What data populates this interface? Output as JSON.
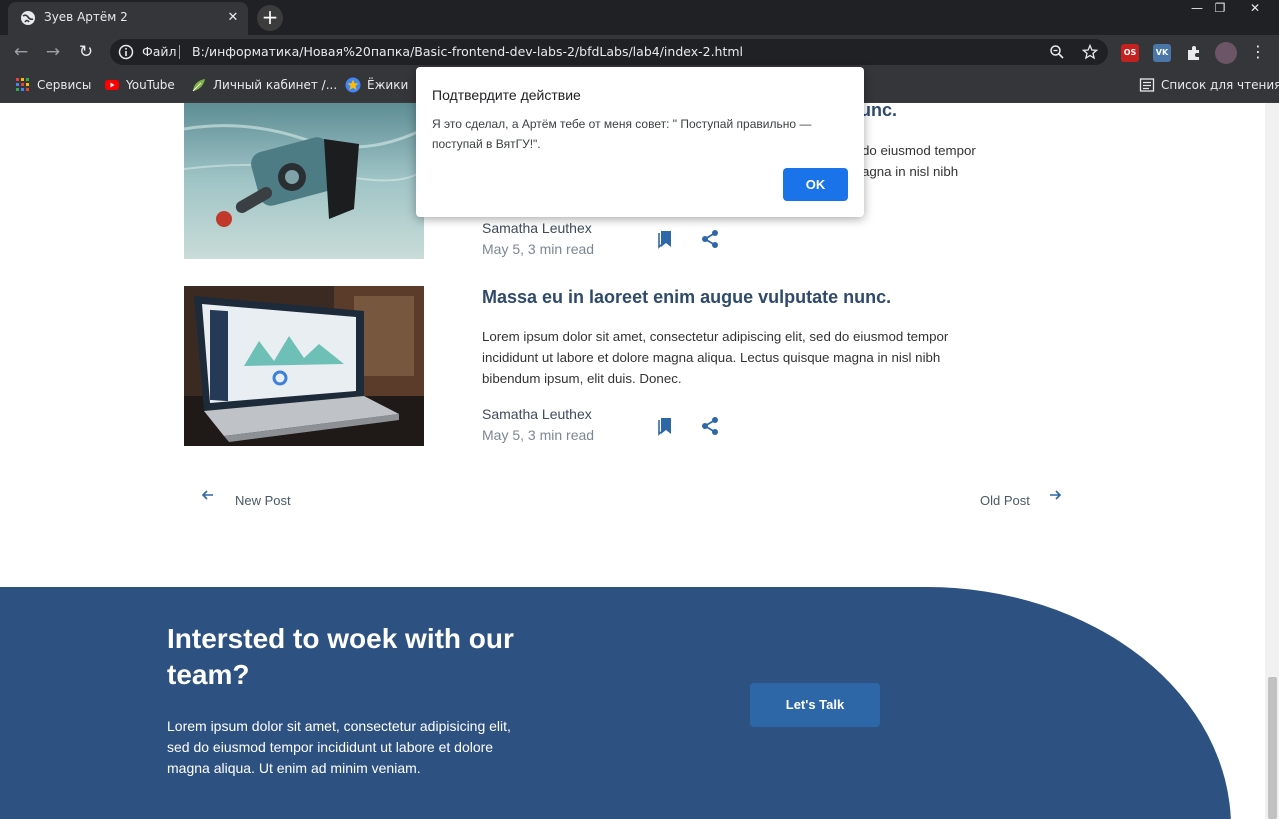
{
  "browser": {
    "tab_title": "Зуев Артём 2",
    "close_tab": "✕",
    "new_tab": "+",
    "window_controls": [
      "—",
      "❐",
      "✕"
    ],
    "file_label": "Файл",
    "url": "B:/информатика/Новая%20папка/Basic-frontend-dev-labs-2/bfdLabs/lab4/index-2.html",
    "bookmarks": [
      {
        "label": "Сервисы",
        "icon": "apps-grid-icon"
      },
      {
        "label": "YouTube",
        "icon": "youtube-icon"
      },
      {
        "label": "Личный кабинет /...",
        "icon": "leaf-icon"
      },
      {
        "label": "Ёжики",
        "icon": "star-badge-icon"
      }
    ],
    "reading_list": "Список для чтения",
    "extensions": [
      "OS",
      "VK"
    ]
  },
  "posts": [
    {
      "title": "unc.",
      "body": "do eiusmod tempor\nagna in nisl nibh",
      "author": "Samatha Leuthex",
      "date": "May 5, 3 min read"
    },
    {
      "title": "Massa eu in laoreet enim augue vulputate nunc.",
      "body": "Lorem ipsum dolor sit amet, consectetur adipiscing elit, sed do eiusmod tempor incididunt ut labore et dolore magna aliqua. Lectus quisque magna in nisl nibh bibendum ipsum, elit duis. Donec.",
      "author": "Samatha Leuthex",
      "date": "May 5, 3 min read"
    }
  ],
  "pager": {
    "new_post": "New Post",
    "old_post": "Old Post"
  },
  "cta": {
    "title": "Intersted to woek with our team?",
    "text": "Lorem ipsum dolor sit amet, consectetur adipisicing elit, sed do eiusmod tempor incididunt ut labore et dolore magna aliqua. Ut enim ad minim veniam.",
    "button": "Let's Talk"
  },
  "dialog": {
    "title": "Подтвердите действие",
    "message": "Я это сделал, а Артём тебе от меня совет: \" Поступай правильно — поступай в ВятГУ!\".",
    "ok": "OK"
  },
  "colors": {
    "accent_dark_blue": "#2d5180",
    "button_blue": "#2e67a8",
    "dialog_ok": "#1a73e8",
    "title_color": "#2f4a6d"
  }
}
